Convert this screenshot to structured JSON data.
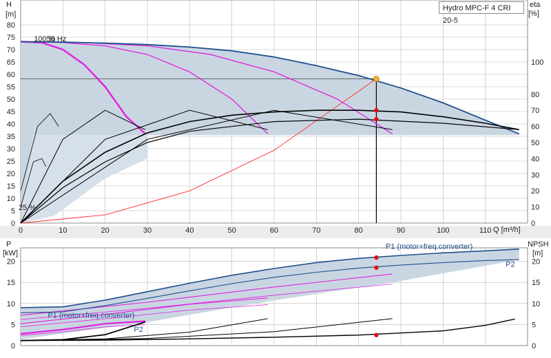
{
  "legend": {
    "model": "Hydro MPC-F 4 CRI 20-5"
  },
  "chart_data": [
    {
      "type": "line",
      "panel": "head-efficiency",
      "xlabel": "Q [m³/h]",
      "ylabel_left": "H",
      "ylabel_left_unit": "[m]",
      "ylabel_right": "eta",
      "ylabel_right_unit": "[%]",
      "xlim": [
        0,
        120
      ],
      "ylim_left": [
        0,
        85
      ],
      "ylim_right": [
        0,
        100
      ],
      "x_ticks": [
        0,
        10,
        20,
        30,
        40,
        50,
        60,
        70,
        80,
        90,
        100,
        110
      ],
      "y_left_ticks": [
        0,
        5,
        10,
        15,
        20,
        25,
        30,
        35,
        40,
        45,
        50,
        55,
        60,
        65,
        70,
        75,
        80
      ],
      "y_right_ticks": [
        0,
        10,
        20,
        30,
        40,
        50,
        60,
        70,
        80,
        100
      ],
      "grid": true,
      "annotations": [
        {
          "text": "100 %",
          "x": 1.5,
          "y": 73
        },
        {
          "text": "50 Hz",
          "x": 4.5,
          "y": 73
        },
        {
          "text": "25 %",
          "x": 0,
          "y": 5
        }
      ],
      "head_envelope": {
        "x": [
          0,
          10,
          20,
          30,
          40,
          50,
          60,
          70,
          80,
          90,
          100,
          110,
          118
        ],
        "y": [
          73.2,
          73,
          72.6,
          72,
          71,
          69.5,
          67,
          63.5,
          59.5,
          54.5,
          48.5,
          41.5,
          36
        ]
      },
      "head_partial_speed": [
        {
          "x": [
            0,
            5,
            10,
            15,
            20,
            25,
            29.5
          ],
          "y": [
            73.2,
            72.8,
            70,
            64,
            55,
            43,
            36
          ]
        },
        {
          "x": [
            0,
            10,
            20,
            30,
            40,
            50,
            58.5
          ],
          "y": [
            73.2,
            72.8,
            71.5,
            68,
            61,
            50,
            36
          ]
        },
        {
          "x": [
            0,
            15,
            30,
            45,
            60,
            75,
            88
          ],
          "y": [
            73.2,
            72.8,
            71.5,
            68,
            61,
            50,
            36
          ]
        }
      ],
      "system_curve": {
        "x": [
          0,
          20,
          40,
          60,
          84.2
        ],
        "y": [
          0,
          3.3,
          13,
          29.4,
          58.2
        ]
      },
      "duty_point": {
        "q": 84.2,
        "h": 58.2
      },
      "efficiency_main": {
        "x": [
          0,
          10,
          20,
          30,
          40,
          50,
          60,
          70,
          80,
          90,
          100,
          110,
          118
        ],
        "eta": [
          0,
          26,
          44,
          56,
          63,
          67,
          69,
          70,
          70,
          69,
          66,
          62,
          58
        ]
      },
      "efficiency_partial": [
        {
          "x": [
            0,
            10,
            20,
            29.5
          ],
          "eta": [
            0,
            52,
            70,
            58
          ]
        },
        {
          "x": [
            0,
            20,
            40,
            58.5
          ],
          "eta": [
            0,
            52,
            70,
            58
          ]
        },
        {
          "x": [
            0,
            30,
            60,
            88
          ],
          "eta": [
            0,
            52,
            70,
            58
          ]
        }
      ],
      "efficiency_markers": [
        {
          "q": 84.2,
          "eta": 70
        },
        {
          "q": 84.2,
          "eta": 64.5
        }
      ]
    },
    {
      "type": "line",
      "panel": "power-npsh",
      "xlabel": "",
      "ylabel_left": "P",
      "ylabel_left_unit": "[kW]",
      "ylabel_right": "NPSH",
      "ylabel_right_unit": "[m]",
      "xlim": [
        0,
        120
      ],
      "ylim_left": [
        0,
        22.5
      ],
      "ylim_right": [
        0,
        22.5
      ],
      "y_left_ticks": [
        0,
        5,
        10,
        15,
        20
      ],
      "y_right_ticks": [
        0,
        5,
        10,
        15,
        20
      ],
      "grid": true,
      "series_labels": [
        {
          "text": "P1 (motor+freq.converter)",
          "x": 107,
          "y": 23.6
        },
        {
          "text": "P2",
          "x": 117,
          "y": 19.4
        },
        {
          "text": "P1 (motor+freq.converter)",
          "x": 27,
          "y": 7.3
        },
        {
          "text": "P2",
          "x": 29,
          "y": 3.9
        }
      ],
      "p1": {
        "x": [
          0,
          10,
          20,
          30,
          40,
          50,
          60,
          70,
          80,
          90,
          100,
          110,
          118
        ],
        "y": [
          9,
          9.2,
          10.8,
          12.8,
          14.8,
          16.7,
          18.3,
          19.7,
          20.7,
          21.4,
          22,
          22.5,
          22.9
        ]
      },
      "p2": {
        "x": [
          0,
          10,
          20,
          30,
          40,
          50,
          60,
          70,
          80,
          90,
          100,
          110,
          118
        ],
        "y": [
          7.8,
          8,
          9.5,
          11.2,
          13,
          14.7,
          16.2,
          17.4,
          18.4,
          19.1,
          19.7,
          20.2,
          20.4
        ]
      },
      "p1_partial": [
        {
          "x": [
            0,
            10,
            20,
            29.5
          ],
          "y": [
            2.8,
            3.8,
            5.2,
            5.8
          ]
        },
        {
          "x": [
            0,
            20,
            40,
            58.5
          ],
          "y": [
            5.2,
            7.4,
            9.8,
            11.3
          ]
        },
        {
          "x": [
            0,
            30,
            60,
            88
          ],
          "y": [
            7.2,
            10.3,
            13.9,
            17
          ]
        }
      ],
      "power_markers": [
        {
          "q": 84.2,
          "p": 20.9
        },
        {
          "q": 84.2,
          "p": 18.5
        }
      ],
      "npsh": {
        "x": [
          0,
          20,
          40,
          60,
          80,
          100,
          110,
          117
        ],
        "y": [
          1.2,
          1.3,
          1.6,
          2,
          2.5,
          3.5,
          4.8,
          6.3
        ]
      },
      "npsh_partial": [
        {
          "x": [
            0,
            10,
            20,
            29.5
          ],
          "y": [
            1.2,
            1.4,
            2.6,
            5.6
          ]
        },
        {
          "x": [
            0,
            20,
            40,
            58.5
          ],
          "y": [
            1.2,
            1.6,
            3.2,
            6.4
          ]
        },
        {
          "x": [
            0,
            30,
            60,
            88
          ],
          "y": [
            1.2,
            1.7,
            3.3,
            6.4
          ]
        }
      ],
      "npsh_marker": {
        "q": 84.2,
        "npsh": 2.5
      }
    }
  ],
  "colors": {
    "envelope_fill": "#c9d6e2",
    "envelope_line": "#1f4e8c",
    "partial_head": "#e020e0",
    "system_curve": "#ff2a2a",
    "marker": "#e01010",
    "duty_point": "#f2b233",
    "efficiency": "#000000",
    "grid": "#b8b8b8",
    "panel_gap": "#ececec"
  }
}
